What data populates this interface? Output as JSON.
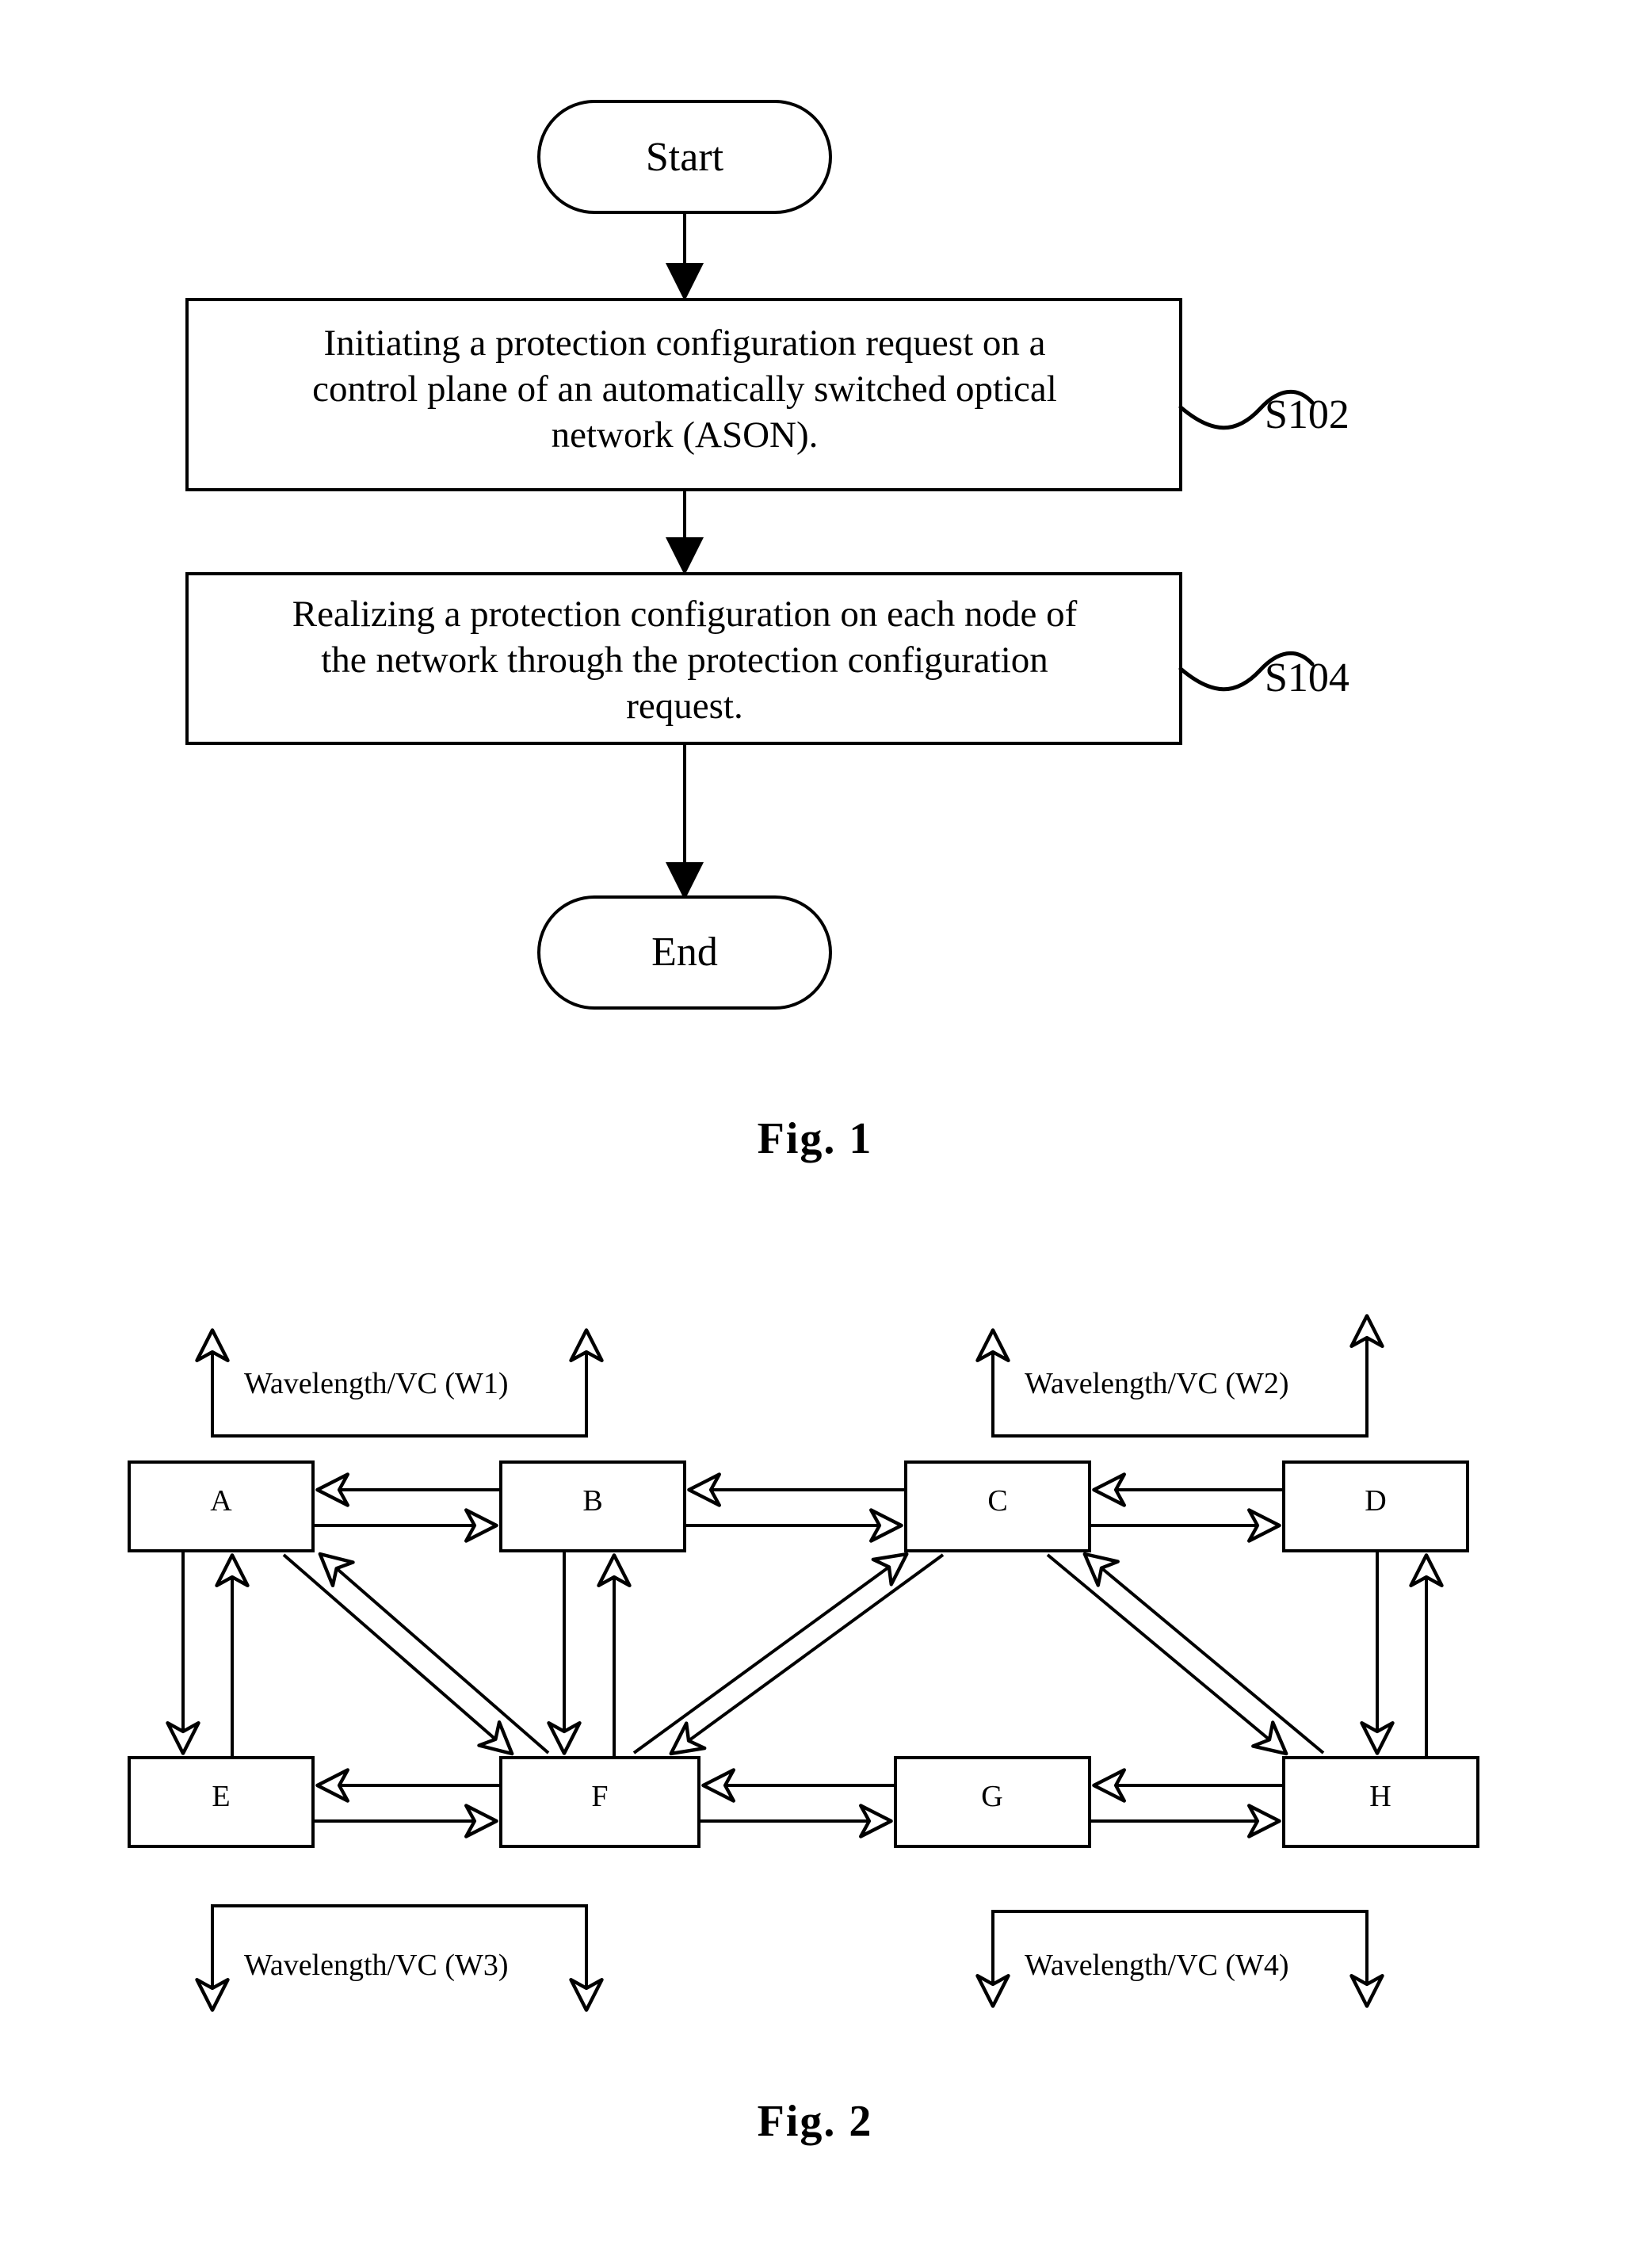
{
  "figures": [
    {
      "id": "fig1",
      "caption": "Fig. 1",
      "type": "flowchart",
      "nodes": [
        {
          "id": "start",
          "shape": "terminal",
          "label": "Start"
        },
        {
          "id": "s102",
          "shape": "process",
          "label": "Initiating a protection configuration request on a control plane of an automatically switched optical network (ASON).",
          "lines": [
            "Initiating a protection configuration request on a",
            "control plane of an automatically switched optical",
            "network (ASON)."
          ],
          "step_ref": "S102"
        },
        {
          "id": "s104",
          "shape": "process",
          "label": "Realizing a protection configuration on each node of the network through the protection configuration request.",
          "lines": [
            "Realizing a protection configuration on each node of",
            "the network through the protection configuration",
            "request."
          ],
          "step_ref": "S104"
        },
        {
          "id": "end",
          "shape": "terminal",
          "label": "End"
        }
      ],
      "edges": [
        {
          "from": "start",
          "to": "s102"
        },
        {
          "from": "s102",
          "to": "s104"
        },
        {
          "from": "s104",
          "to": "end"
        }
      ]
    },
    {
      "id": "fig2",
      "caption": "Fig. 2",
      "type": "network-topology",
      "nodes": [
        {
          "id": "A",
          "label": "A",
          "row": "top"
        },
        {
          "id": "B",
          "label": "B",
          "row": "top"
        },
        {
          "id": "C",
          "label": "C",
          "row": "top"
        },
        {
          "id": "D",
          "label": "D",
          "row": "top"
        },
        {
          "id": "E",
          "label": "E",
          "row": "bottom"
        },
        {
          "id": "F",
          "label": "F",
          "row": "bottom"
        },
        {
          "id": "G",
          "label": "G",
          "row": "bottom"
        },
        {
          "id": "H",
          "label": "H",
          "row": "bottom"
        }
      ],
      "links": [
        {
          "from": "A",
          "to": "B",
          "kind": "horizontal",
          "bidirectional": true
        },
        {
          "from": "B",
          "to": "C",
          "kind": "horizontal",
          "bidirectional": true
        },
        {
          "from": "C",
          "to": "D",
          "kind": "horizontal",
          "bidirectional": true
        },
        {
          "from": "E",
          "to": "F",
          "kind": "horizontal",
          "bidirectional": true
        },
        {
          "from": "F",
          "to": "G",
          "kind": "horizontal",
          "bidirectional": true
        },
        {
          "from": "G",
          "to": "H",
          "kind": "horizontal",
          "bidirectional": true
        },
        {
          "from": "A",
          "to": "E",
          "kind": "vertical",
          "bidirectional": true
        },
        {
          "from": "B",
          "to": "F",
          "kind": "vertical",
          "bidirectional": true
        },
        {
          "from": "D",
          "to": "H",
          "kind": "vertical",
          "bidirectional": true
        },
        {
          "from": "A",
          "to": "F",
          "kind": "diagonal",
          "bidirectional": true
        },
        {
          "from": "C",
          "to": "F",
          "kind": "diagonal",
          "bidirectional": true
        },
        {
          "from": "C",
          "to": "H",
          "kind": "diagonal",
          "bidirectional": true
        }
      ],
      "wavelength_labels": [
        {
          "id": "W1",
          "text": "Wavelength/VC (W1)",
          "position": "top-left",
          "direction": "up"
        },
        {
          "id": "W2",
          "text": "Wavelength/VC (W2)",
          "position": "top-right",
          "direction": "up"
        },
        {
          "id": "W3",
          "text": "Wavelength/VC (W3)",
          "position": "bottom-left",
          "direction": "down"
        },
        {
          "id": "W4",
          "text": "Wavelength/VC (W4)",
          "position": "bottom-right",
          "direction": "down"
        }
      ]
    }
  ],
  "colors": {
    "ink": "#000000",
    "paper": "#ffffff"
  }
}
